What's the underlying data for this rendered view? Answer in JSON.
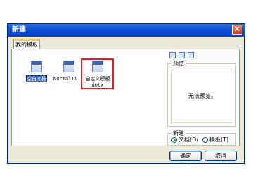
{
  "window": {
    "title": "新建",
    "close_glyph": "×"
  },
  "tabs": [
    {
      "label": "我的模板",
      "active": true
    }
  ],
  "templates": [
    {
      "label": "空白文档",
      "icon": "blank-document-icon",
      "selected": true
    },
    {
      "label": "Normal11...",
      "icon": "word-document-icon",
      "selected": false
    },
    {
      "label": "自定义模板",
      "sublabel": "dotx",
      "icon": "word-template-icon",
      "selected": false,
      "highlighted": true
    }
  ],
  "view_buttons": [
    "large-icons-view-icon",
    "list-view-icon",
    "details-view-icon"
  ],
  "preview": {
    "legend": "预览",
    "message": "无法预览。"
  },
  "create_new": {
    "legend": "新建",
    "options": [
      {
        "label": "文档(D)",
        "checked": true
      },
      {
        "label": "模板(T)",
        "checked": false
      }
    ]
  },
  "buttons": {
    "ok": "确定",
    "cancel": "取消"
  },
  "colors": {
    "title_bar": "#0b4fd4",
    "dialog_bg": "#ece9d8",
    "selection": "#316ac5",
    "highlight_box": "#e02020"
  }
}
